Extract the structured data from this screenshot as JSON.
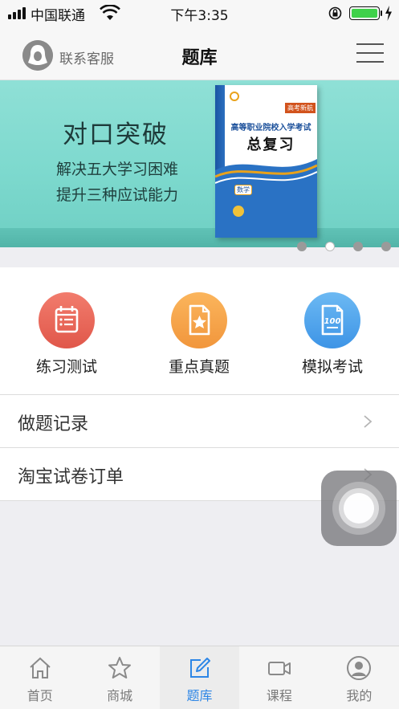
{
  "status_bar": {
    "carrier": "中国联通",
    "time": "下午3:35",
    "battery_level": 1.0
  },
  "header": {
    "contact_label": "联系客服",
    "title": "题库",
    "menu_icon": "hamburger-menu-icon"
  },
  "banner": {
    "title": "对口突破",
    "line1": "解决五大学习困难",
    "line2": "提升三种应试能力",
    "book": {
      "subtitle": "高等职业院校入学考试",
      "title": "总复习",
      "edition": "高考新航",
      "badge": "数学"
    },
    "dots_count": 4,
    "active_dot": 2
  },
  "quick_actions": [
    {
      "label": "练习测试",
      "icon": "calendar-checklist-icon",
      "color": "#e8634f"
    },
    {
      "label": "重点真题",
      "icon": "star-document-icon",
      "color": "#f4a447"
    },
    {
      "label": "模拟考试",
      "icon": "score-100-icon",
      "color": "#4a9fea"
    }
  ],
  "list": [
    {
      "label": "做题记录"
    },
    {
      "label": "淘宝试卷订单"
    }
  ],
  "tabbar": [
    {
      "label": "首页",
      "icon": "home-icon",
      "active": false
    },
    {
      "label": "商城",
      "icon": "star-icon",
      "active": false
    },
    {
      "label": "题库",
      "icon": "edit-icon",
      "active": true
    },
    {
      "label": "课程",
      "icon": "video-camera-icon",
      "active": false
    },
    {
      "label": "我的",
      "icon": "user-icon",
      "active": false
    }
  ],
  "colors": {
    "accent": "#2d86e6",
    "banner": "#7dd9ce",
    "battery": "#3fd14a"
  }
}
